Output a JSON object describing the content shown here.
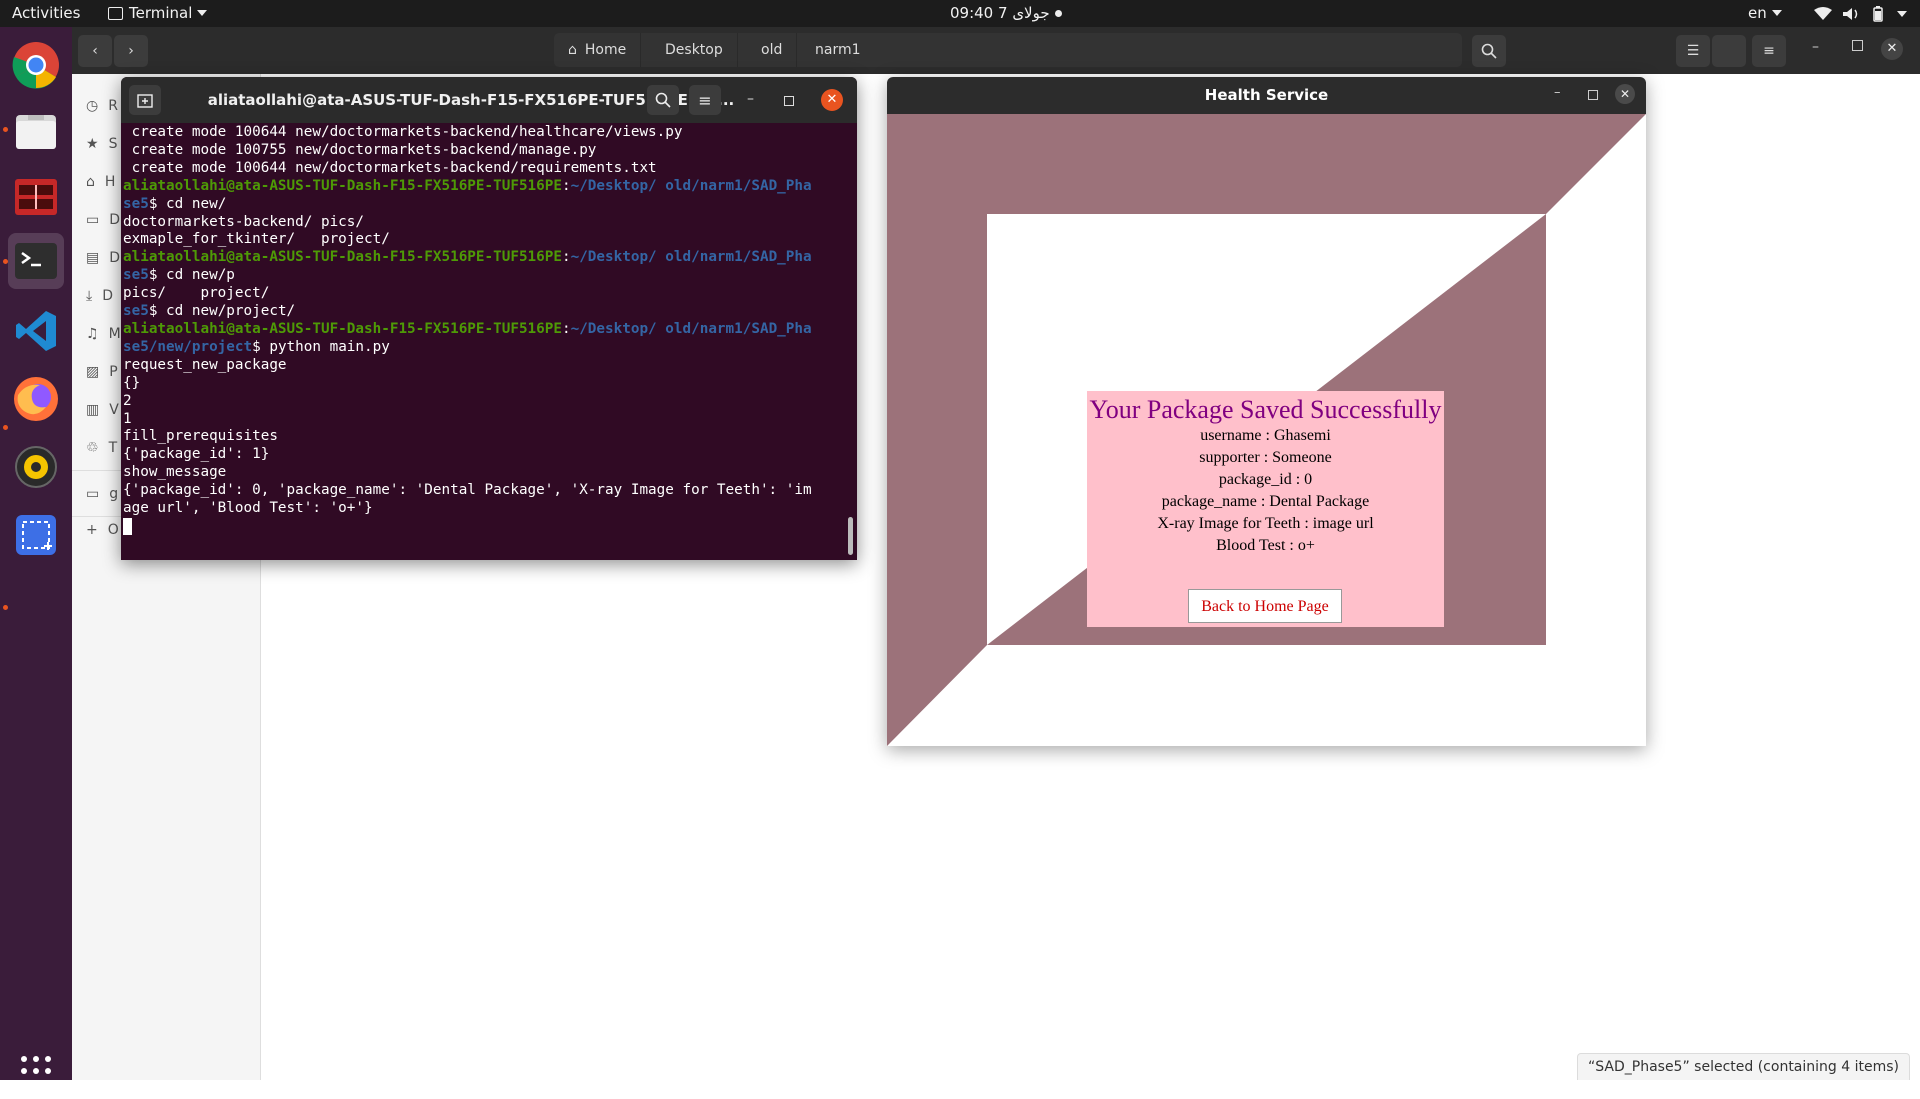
{
  "topbar": {
    "activities": "Activities",
    "app_name": "Terminal",
    "clock": "09:40  جولای 7",
    "language": "en"
  },
  "dock": {
    "apps": [
      "chrome-icon",
      "files-icon",
      "app-icon",
      "terminal-icon",
      "vscode-icon",
      "firefox-icon",
      "rhythmbox-icon",
      "screenshot-icon",
      "app-grid-icon"
    ]
  },
  "files": {
    "breadcrumbs": [
      "Home",
      "Desktop",
      "old",
      "narm1"
    ],
    "sidebar": [
      "R",
      "S",
      "H",
      "D",
      "D",
      "D",
      "M",
      "P",
      "V",
      "T",
      "g",
      "O"
    ],
    "status": "“SAD_Phase5” selected  (containing 4 items)"
  },
  "terminal": {
    "title": "aliataollahi@ata-ASUS-TUF-Dash-F15-FX516PE-TUF516PE: ~/...",
    "lines": [
      [
        {
          "t": " create mode 100644 new/doctormarkets-backend/healthcare/views.py"
        }
      ],
      [
        {
          "t": " create mode 100755 new/doctormarkets-backend/manage.py"
        }
      ],
      [
        {
          "t": " create mode 100644 new/doctormarkets-backend/requirements.txt"
        }
      ],
      [
        {
          "c": "user",
          "t": "aliataollahi@ata-ASUS-TUF-Dash-F15-FX516PE-TUF516PE"
        },
        {
          "t": ":"
        },
        {
          "c": "path",
          "t": "~/Desktop/ old/narm1/SAD_Pha"
        }
      ],
      [
        {
          "c": "path",
          "t": "se5"
        },
        {
          "t": "$ cd new/"
        }
      ],
      [
        {
          "t": "doctormarkets-backend/ pics/"
        }
      ],
      [
        {
          "t": "exmaple_for_tkinter/   project/"
        }
      ],
      [
        {
          "c": "user",
          "t": "aliataollahi@ata-ASUS-TUF-Dash-F15-FX516PE-TUF516PE"
        },
        {
          "t": ":"
        },
        {
          "c": "path",
          "t": "~/Desktop/ old/narm1/SAD_Pha"
        }
      ],
      [
        {
          "c": "path",
          "t": "se5"
        },
        {
          "t": "$ cd new/p"
        }
      ],
      [
        {
          "t": "pics/    project/"
        }
      ],
      [
        {
          "c": "path",
          "t": "se5"
        },
        {
          "t": "$ cd new/project/"
        }
      ],
      [
        {
          "c": "user",
          "t": "aliataollahi@ata-ASUS-TUF-Dash-F15-FX516PE-TUF516PE"
        },
        {
          "t": ":"
        },
        {
          "c": "path",
          "t": "~/Desktop/ old/narm1/SAD_Pha"
        }
      ],
      [
        {
          "c": "path",
          "t": "se5/new/project"
        },
        {
          "t": "$ python main.py"
        }
      ],
      [
        {
          "t": "request_new_package"
        }
      ],
      [
        {
          "t": "{}"
        }
      ],
      [
        {
          "t": "2"
        }
      ],
      [
        {
          "t": "1"
        }
      ],
      [
        {
          "t": "fill_prerequisites"
        }
      ],
      [
        {
          "t": "{'package_id': 1}"
        }
      ],
      [
        {
          "t": "show_message"
        }
      ],
      [
        {
          "t": "{'package_id': 0, 'package_name': 'Dental Package', 'X-ray Image for Teeth': 'im"
        }
      ],
      [
        {
          "t": "age url', 'Blood Test': 'o+'}"
        }
      ]
    ]
  },
  "health": {
    "window_title": "Health Service",
    "heading": "Your Package Saved Successfully",
    "lines": [
      "username : Ghasemi",
      "supporter : Someone",
      "package_id : 0",
      "package_name : Dental Package",
      "X-ray Image for Teeth : image url",
      "Blood Test : o+"
    ],
    "button": "Back to Home Page"
  },
  "colors": {
    "dock": "#3a1c3a",
    "terminal_bg": "#300a24",
    "prompt_user": "#4e9a06",
    "prompt_path": "#3465a4",
    "frame_mauve": "#9c727a",
    "message_bg": "#ffc0cb",
    "heading": "#800080",
    "button_text": "#cc0000",
    "close_orange": "#e95420"
  }
}
